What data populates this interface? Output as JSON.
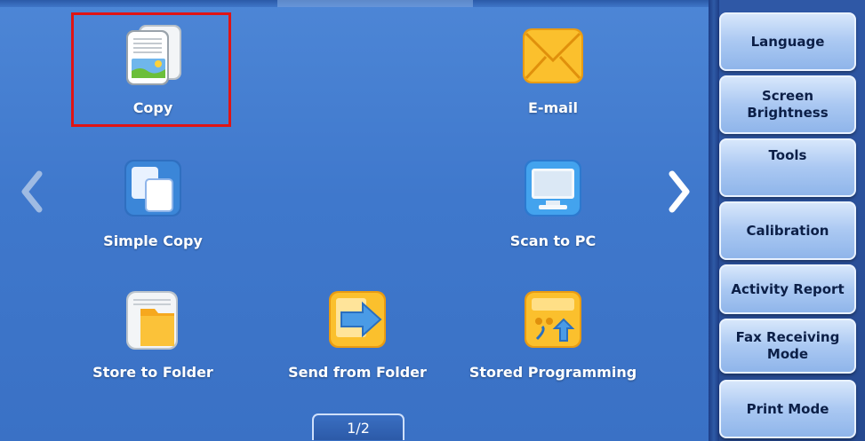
{
  "main": {
    "tiles": {
      "copy": "Copy",
      "email": "E-mail",
      "simple_copy": "Simple Copy",
      "scan_to_pc": "Scan to PC",
      "store_to_folder": "Store to Folder",
      "send_from_folder": "Send from Folder",
      "stored_programming": "Stored Programming"
    },
    "selected_tile": "Copy",
    "page_indicator": "1/2"
  },
  "side_panel": {
    "buttons": {
      "language": "Language",
      "screen_brightness": "Screen Brightness",
      "tools": "Tools",
      "calibration": "Calibration",
      "activity_report": "Activity Report",
      "fax_receiving_mode": "Fax Receiving Mode",
      "print_mode": "Print Mode"
    }
  },
  "icons": {
    "copy": "copy-document-icon",
    "email": "envelope-icon",
    "simple_copy": "simple-copy-icon",
    "scan_to_pc": "computer-monitor-icon",
    "store_to_folder": "folder-document-icon",
    "send_from_folder": "folder-arrow-icon",
    "stored_programming": "stored-programming-icon",
    "prev": "chevron-left-icon",
    "next": "chevron-right-icon"
  },
  "colors": {
    "selection": "#e01414",
    "background": "#3f78cc",
    "button_text": "#0c1f47"
  }
}
